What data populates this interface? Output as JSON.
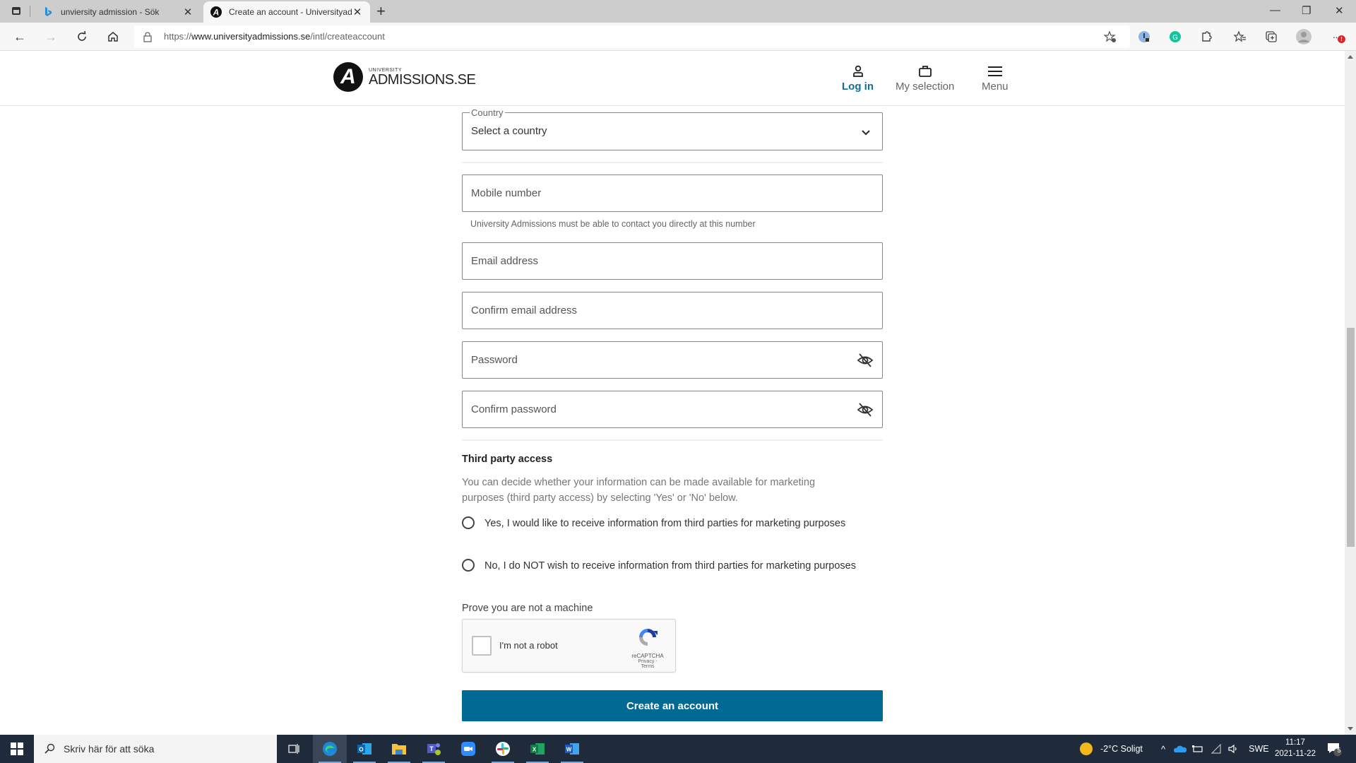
{
  "browser": {
    "tabs": [
      {
        "title": "unviersity admission - Sök",
        "favicon": "bing-icon",
        "active": false
      },
      {
        "title": "Create an account - Universityad",
        "favicon": "admissions-logo-icon",
        "active": true
      }
    ],
    "new_tab_label": "+",
    "url_prefix": "https://",
    "url_domain": "www.universityadmissions.se",
    "url_path": "/intl/createaccount",
    "window_controls": {
      "minimize": "—",
      "restore": "❐",
      "close": "✕"
    },
    "more_label": "···",
    "notification_badge": "!"
  },
  "header": {
    "logo_mark": "A",
    "logo_small": "UNIVERSITY",
    "logo_big": "ADMISSIONS.SE",
    "nav": [
      {
        "label": "Log in",
        "icon": "user-icon"
      },
      {
        "label": "My selection",
        "icon": "briefcase-icon"
      },
      {
        "label": "Menu",
        "icon": "hamburger-icon"
      }
    ]
  },
  "form": {
    "country": {
      "legend": "Country",
      "value": "Select a country"
    },
    "mobile": {
      "placeholder": "Mobile number",
      "hint": "University Admissions must be able to contact you directly at this number"
    },
    "email": {
      "placeholder": "Email address"
    },
    "confirm_email": {
      "placeholder": "Confirm email address"
    },
    "password": {
      "placeholder": "Password"
    },
    "confirm_password": {
      "placeholder": "Confirm password"
    },
    "third_party": {
      "heading": "Third party access",
      "description": "You can decide whether your information can be made available for marketing purposes (third party access) by selecting 'Yes' or 'No' below.",
      "options": [
        {
          "label": "Yes, I would like to receive information from third parties for marketing purposes",
          "checked": false
        },
        {
          "label": "No, I do NOT wish to receive information from third parties for marketing purposes",
          "checked": false
        }
      ]
    },
    "captcha": {
      "prompt": "Prove you are not a machine",
      "checkbox_label": "I'm not a robot",
      "brand": "reCAPTCHA",
      "terms": "Privacy - Terms",
      "checked": false
    },
    "submit_label": "Create an account"
  },
  "colors": {
    "accent": "#006a94",
    "login_link": "#0f6f9a"
  },
  "taskbar": {
    "search_placeholder": "Skriv här för att söka",
    "apps": [
      "task-view",
      "edge",
      "outlook",
      "file-explorer",
      "teams",
      "zoom",
      "slack",
      "excel",
      "word"
    ],
    "weather": "-2°C  Soligt",
    "language": "SWE",
    "time": "11:17",
    "date": "2021-11-22",
    "notification_count": "5"
  }
}
